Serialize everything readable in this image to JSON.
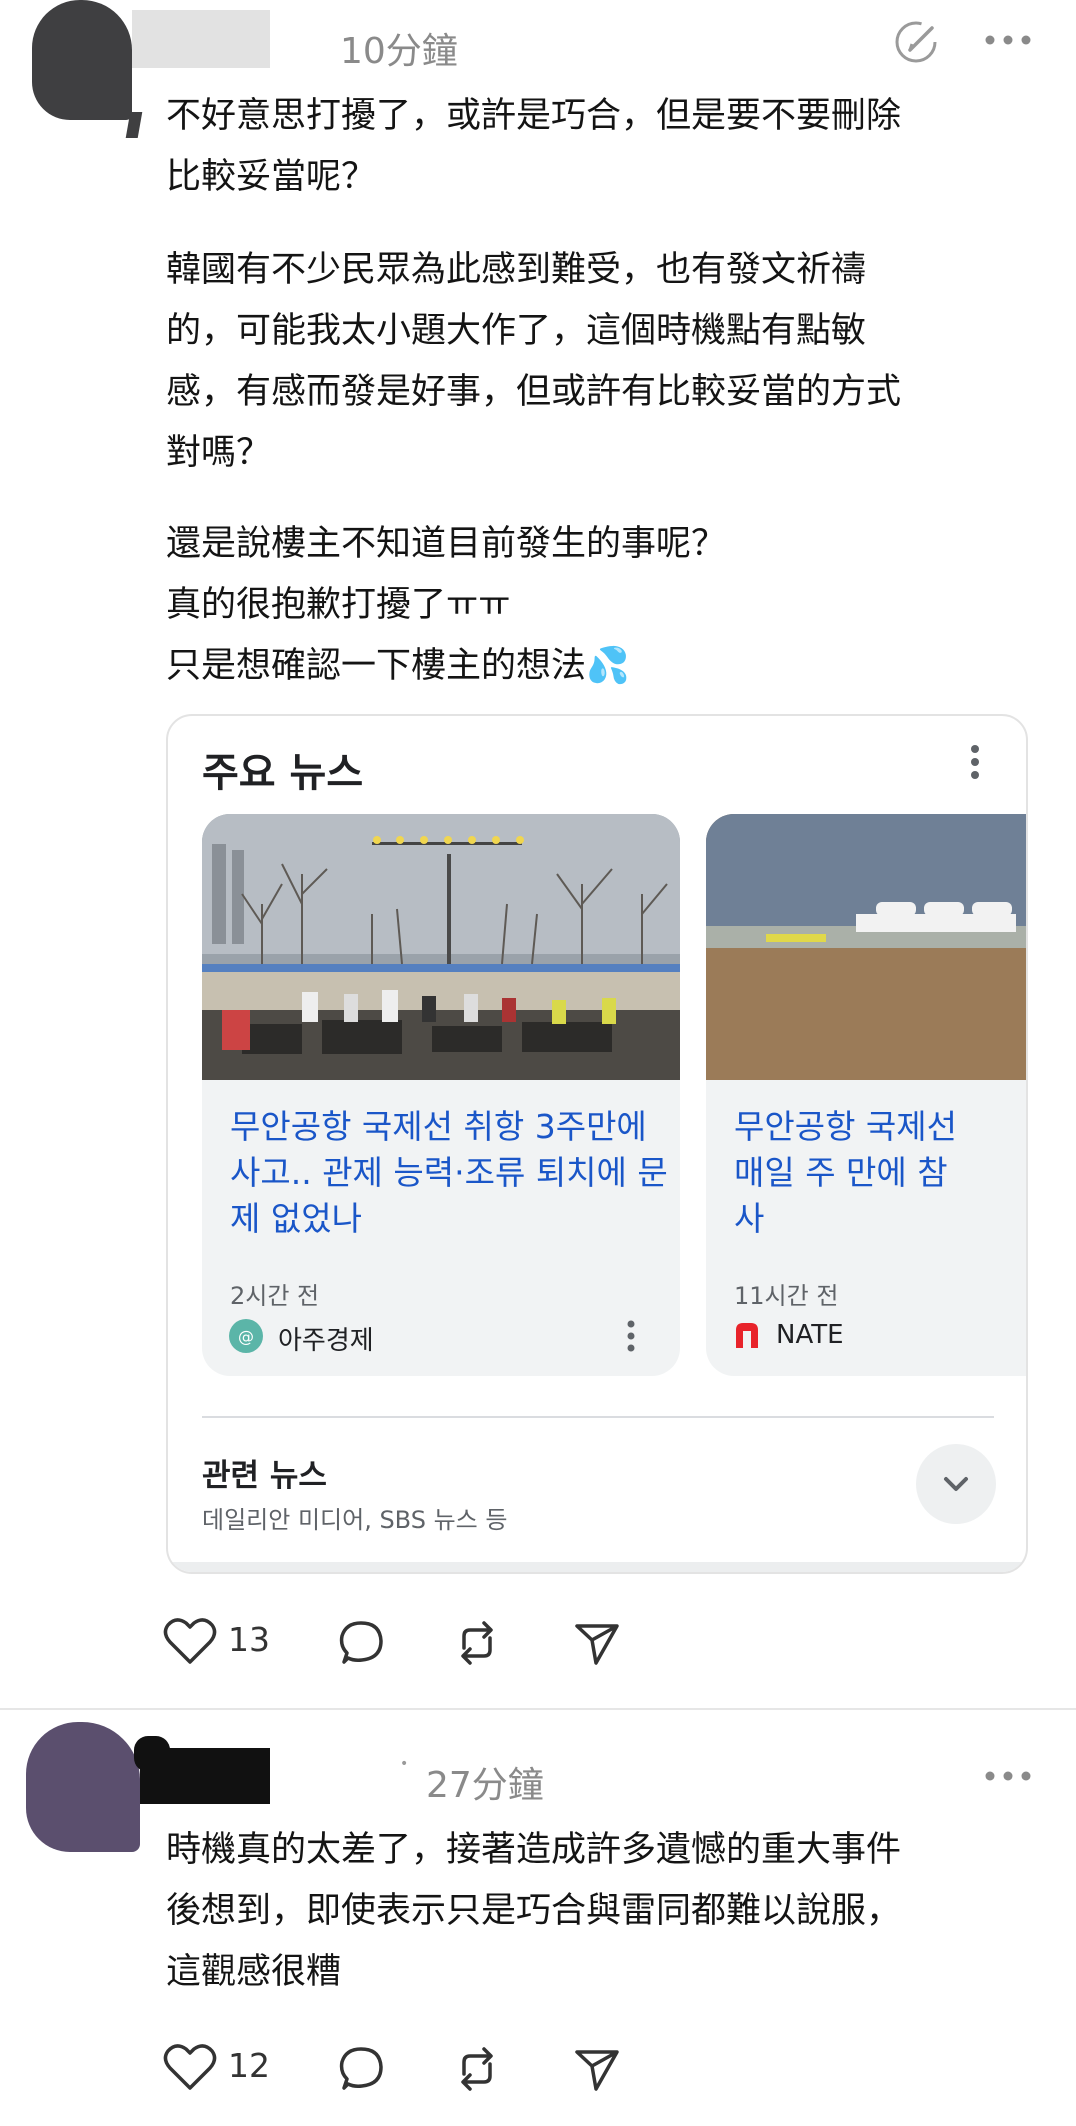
{
  "post1": {
    "time": "10分鐘",
    "paragraphs": [
      "不好意思打擾了，或許是巧合，但是要不要刪除\n比較妥當呢？",
      "韓國有不少民眾為此感到難受，也有發文祈禱\n的，可能我太小題大作了，這個時機點有點敏\n感，有感而發是好事，但或許有比較妥當的方式\n對嗎？",
      "還是說樓主不知道目前發生的事呢？\n真的很抱歉打擾了ㅠㅠ\n只是想確認一下樓主的想法💦"
    ],
    "likes": "13"
  },
  "news_card": {
    "title": "주요 뉴스",
    "articles": [
      {
        "headline": "무안공항 국제선 취항 3주만에 사고.. 관제 능력·조류 퇴치에 문제 없었나",
        "time": "2시간 전",
        "source": "아주경제"
      },
      {
        "headline": "무안공항 국제선 매일 주 만에 참사",
        "time": "11시간 전",
        "source": "NATE"
      }
    ],
    "related_title": "관련 뉴스",
    "related_sub": "데일리안 미디어, SBS 뉴스 등"
  },
  "post2": {
    "time": "27分鐘",
    "text": "時機真的太差了，接著造成許多遺憾的重大事件\n後想到，即使表示只是巧合與雷同都難以說服，\n這觀感很糟",
    "likes": "12"
  },
  "icons": [
    "edit-icon",
    "more-icon",
    "heart-icon",
    "comment-icon",
    "repost-icon",
    "share-icon",
    "chevron-down-icon",
    "kebab-icon"
  ],
  "colors": {
    "headline": "#1a56c8",
    "avatar1": "#3f3f41",
    "avatar2": "#5b4f6e",
    "nate_red": "#e8232a"
  }
}
